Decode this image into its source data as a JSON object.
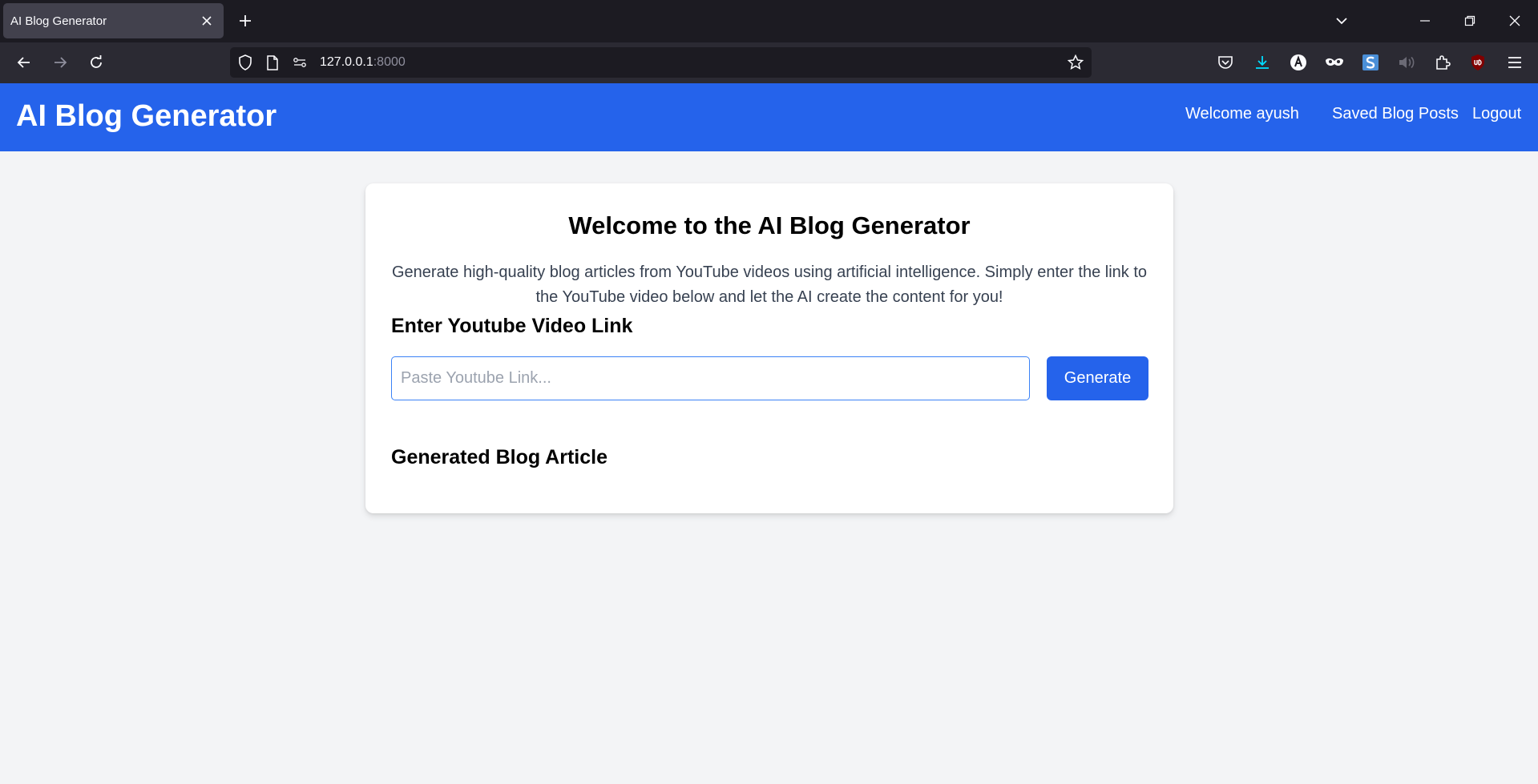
{
  "browser": {
    "tab_title": "AI Blog Generator",
    "url_host": "127.0.0.1",
    "url_port": ":8000"
  },
  "header": {
    "title": "AI Blog Generator",
    "welcome": "Welcome ayush",
    "saved_posts": "Saved Blog Posts",
    "logout": "Logout"
  },
  "main": {
    "title": "Welcome to the AI Blog Generator",
    "description": "Generate high-quality blog articles from YouTube videos using artificial intelligence. Simply enter the link to the YouTube video below and let the AI create the content for you!",
    "link_label": "Enter Youtube Video Link",
    "input_placeholder": "Paste Youtube Link...",
    "input_value": "",
    "generate_label": "Generate",
    "article_heading": "Generated Blog Article"
  },
  "colors": {
    "brand": "#2563eb",
    "background": "#f3f4f6"
  }
}
